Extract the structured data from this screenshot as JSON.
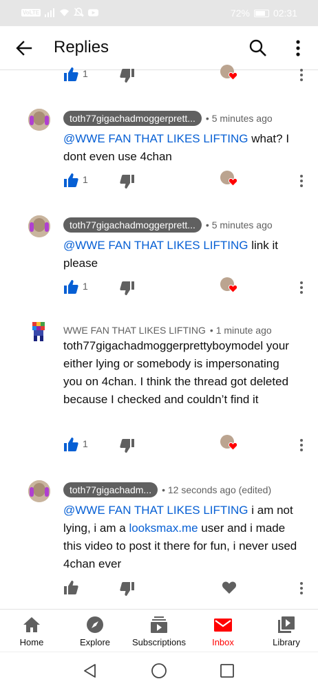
{
  "status_bar": {
    "network_badge": "VoLTE",
    "battery": "72%",
    "battery_level": 0.72,
    "time": "02:31"
  },
  "app_bar": {
    "title": "Replies"
  },
  "top_action_row": {
    "like_count": "1"
  },
  "comments": [
    {
      "author": "toth77gigachadmoggerprett...",
      "author_style": "chip",
      "time": "5 minutes ago",
      "mention": "@WWE FAN THAT LIKES LIFTING",
      "text": " what? I dont even use 4chan",
      "like_count": "1",
      "creator_hearted": true
    },
    {
      "author": "toth77gigachadmoggerprett...",
      "author_style": "chip",
      "time": "5 minutes ago",
      "mention": "@WWE FAN THAT LIKES LIFTING",
      "text": " link it please",
      "like_count": "1",
      "creator_hearted": true
    },
    {
      "author": "WWE FAN THAT LIKES LIFTING",
      "author_style": "plain",
      "time": "1 minute ago",
      "text": "toth77gigachadmoggerprettyboymodel your either lying or somebody is impersonating you on 4chan. I think the thread got deleted because I checked and couldn’t find it",
      "like_count": "1",
      "creator_hearted": true
    },
    {
      "author": "toth77gigachadm...",
      "author_style": "chip",
      "time": "12 seconds ago (edited)",
      "mention": "@WWE FAN THAT LIKES LIFTING",
      "text_before_link": " i am not lying, i am a ",
      "link": "looksmax.me",
      "text_after_link": " user and i made this video to post it there for fun, i never used 4chan ever",
      "like_count": "",
      "creator_hearted": false
    }
  ],
  "bottom_nav": {
    "items": [
      {
        "label": "Home",
        "icon": "home-icon",
        "active": false
      },
      {
        "label": "Explore",
        "icon": "explore-compass-icon",
        "active": false
      },
      {
        "label": "Subscriptions",
        "icon": "subscriptions-icon",
        "active": false
      },
      {
        "label": "Inbox",
        "icon": "inbox-mail-icon",
        "active": true
      },
      {
        "label": "Library",
        "icon": "library-icon",
        "active": false
      }
    ]
  },
  "colors": {
    "link_blue": "#065fd4",
    "like_blue": "#065fd4",
    "heart_red": "#ff0000",
    "active_red": "#ff0000",
    "chip_gray": "#606060",
    "status_bar_bg": "#e6e6e6"
  }
}
